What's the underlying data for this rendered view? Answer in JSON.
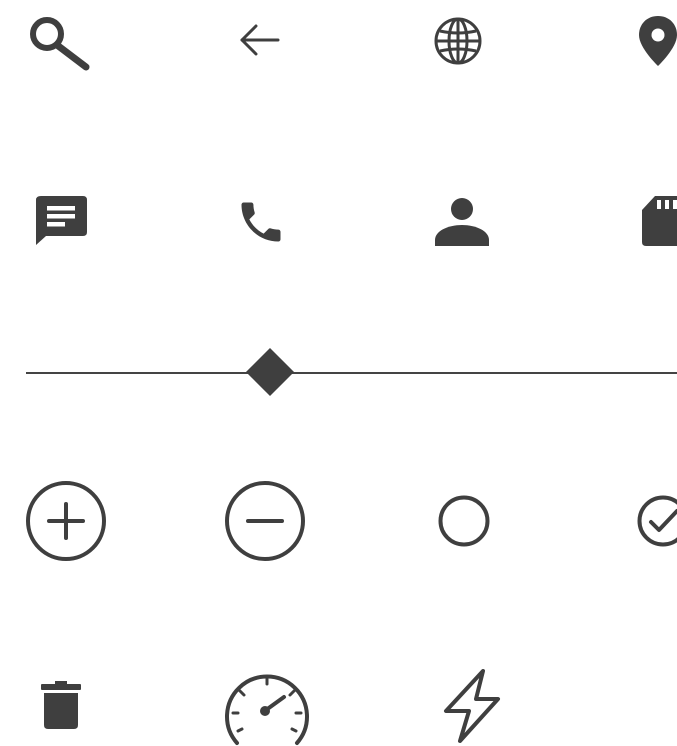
{
  "palette": {
    "icon": "#3f3f3f",
    "background": "#ffffff"
  },
  "icons": {
    "row1": [
      "search-icon",
      "arrow-back-icon",
      "globe-icon",
      "location-pin-icon"
    ],
    "row2": [
      "message-icon",
      "phone-icon",
      "person-icon",
      "sd-card-icon"
    ],
    "row3": [
      "divider-with-diamond"
    ],
    "row4": [
      "add-circle-icon",
      "remove-circle-icon",
      "circle-outline-icon",
      "check-circle-icon"
    ],
    "row5": [
      "delete-icon",
      "speedometer-icon",
      "flash-icon"
    ]
  }
}
